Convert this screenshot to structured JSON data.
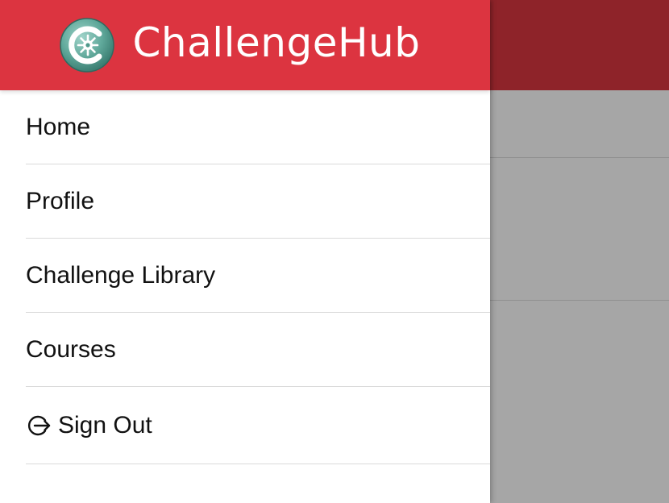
{
  "app": {
    "brand_name": "ChallengeHub",
    "brand_color": "#dc3440",
    "logo_icon": "gear-c-logo"
  },
  "menu": {
    "items": [
      {
        "label": "Home"
      },
      {
        "label": "Profile"
      },
      {
        "label": "Challenge Library"
      },
      {
        "label": "Courses"
      },
      {
        "label": "Sign Out",
        "icon": "sign-out-icon"
      }
    ]
  },
  "overlay": {
    "color": "#000000",
    "opacity": 0.35
  }
}
